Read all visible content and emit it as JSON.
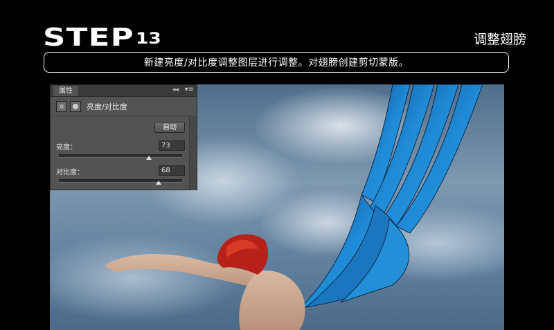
{
  "header": {
    "step_word": "STEP",
    "step_number": "13",
    "section_title": "调整翅膀",
    "caption": "新建亮度/对比度调整图层进行调整。对翅膀创建剪切蒙版。"
  },
  "panel": {
    "tab_label": "属性",
    "collapse_glyph": "◂◂",
    "menu_glyph": "▾≡",
    "adjustment_icon": "sun-icon",
    "mask_icon": "mask-icon",
    "adjustment_name": "亮度/对比度",
    "auto_label": "自动",
    "brightness": {
      "label": "亮度：",
      "value": "73",
      "level": 0.73
    },
    "contrast": {
      "label": "对比度：",
      "value": "68",
      "level": 0.81
    }
  },
  "colors": {
    "wing_blue": "#1f8ad6",
    "hair_red": "#b8201a",
    "sky_blue": "#6e8cab"
  }
}
